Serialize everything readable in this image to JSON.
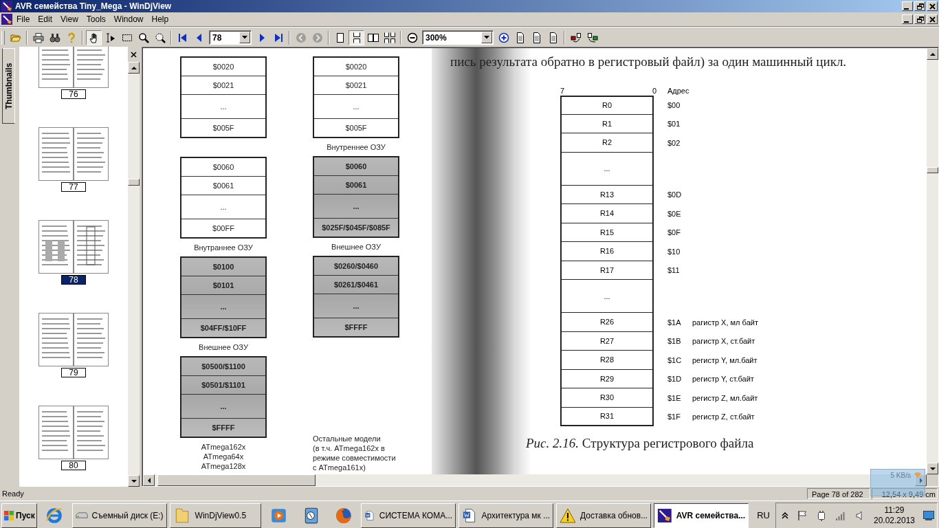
{
  "window": {
    "title": "AVR семейства Tiny_Mega - WinDjView"
  },
  "menu": [
    "File",
    "Edit",
    "View",
    "Tools",
    "Window",
    "Help"
  ],
  "toolbar": [
    [
      {
        "kind": "open",
        "selected": false,
        "disabled": false
      }
    ],
    [
      {
        "kind": "print",
        "selected": false,
        "disabled": false
      },
      {
        "kind": "find",
        "selected": false,
        "disabled": false
      },
      {
        "kind": "help",
        "selected": false,
        "disabled": false
      }
    ],
    [
      {
        "kind": "hand",
        "selected": true,
        "disabled": false
      },
      {
        "kind": "textsel",
        "selected": false,
        "disabled": false
      },
      {
        "kind": "rectsel",
        "selected": false,
        "disabled": false
      },
      {
        "kind": "zoom",
        "selected": false,
        "disabled": false
      },
      {
        "kind": "zoomrect",
        "selected": false,
        "disabled": false
      }
    ],
    [
      {
        "kind": "first",
        "selected": false,
        "disabled": false
      },
      {
        "kind": "prev",
        "selected": false,
        "disabled": false
      },
      {
        "kind": "pagecombo",
        "value": "78"
      },
      {
        "kind": "next",
        "selected": false,
        "disabled": false
      },
      {
        "kind": "last",
        "selected": false,
        "disabled": false
      }
    ],
    [
      {
        "kind": "back",
        "selected": false,
        "disabled": true
      },
      {
        "kind": "forward",
        "selected": false,
        "disabled": true
      }
    ],
    [
      {
        "kind": "single",
        "selected": false,
        "disabled": false
      },
      {
        "kind": "continuous",
        "selected": true,
        "disabled": false
      },
      {
        "kind": "facing",
        "selected": false,
        "disabled": false
      },
      {
        "kind": "facingcont",
        "selected": false,
        "disabled": false
      }
    ],
    [
      {
        "kind": "zoomout",
        "selected": false,
        "disabled": false
      },
      {
        "kind": "zoomcombo",
        "value": "300%"
      },
      {
        "kind": "zoomin",
        "selected": false,
        "disabled": false
      },
      {
        "kind": "page",
        "selected": false,
        "disabled": false
      },
      {
        "kind": "page",
        "selected": false,
        "disabled": false
      },
      {
        "kind": "page",
        "selected": false,
        "disabled": false
      }
    ],
    [
      {
        "kind": "rotl",
        "selected": false,
        "disabled": false
      },
      {
        "kind": "rotr",
        "selected": false,
        "disabled": false
      }
    ]
  ],
  "thumbnails": {
    "tab": "Thumbnails",
    "pages": [
      {
        "label": "76",
        "selected": false
      },
      {
        "label": "77",
        "selected": false
      },
      {
        "label": "78",
        "selected": true
      },
      {
        "label": "79",
        "selected": false
      },
      {
        "label": "80",
        "selected": false
      }
    ]
  },
  "left_page": {
    "columns": [
      [
        {
          "kind": "block",
          "shaded": false,
          "cells": [
            "$0020",
            "$0021",
            "...",
            "$005F"
          ]
        },
        {
          "kind": "block",
          "shaded": false,
          "cells": [
            "$0060",
            "$0061",
            "...",
            "$00FF"
          ]
        },
        {
          "kind": "caption",
          "lines": [
            "Внутраннее ОЗУ"
          ]
        },
        {
          "kind": "block",
          "shaded": true,
          "cells": [
            "$0100",
            "$0101",
            "...",
            "$04FF/$10FF"
          ]
        },
        {
          "kind": "caption",
          "lines": [
            "Внешнее ОЗУ"
          ]
        },
        {
          "kind": "block",
          "shaded": true,
          "cells": [
            "$0500/$1100",
            "$0501/$1101",
            "...",
            "$FFFF"
          ]
        },
        {
          "kind": "caption",
          "lines": [
            "ATmega162x",
            "ATmega64x",
            "ATmega128x"
          ]
        }
      ],
      [
        {
          "kind": "block",
          "shaded": false,
          "cells": [
            "$0020",
            "$0021",
            "...",
            "$005F"
          ]
        },
        {
          "kind": "caption",
          "lines": [
            "Внутреннее ОЗУ"
          ]
        },
        {
          "kind": "block",
          "shaded": true,
          "cells": [
            "$0060",
            "$0061",
            "...",
            "$025F/$045F/$085F"
          ]
        },
        {
          "kind": "caption",
          "lines": [
            "Внешнее ОЗУ"
          ]
        },
        {
          "kind": "block",
          "shaded": true,
          "cells": [
            "$0260/$0460",
            "$0261/$0461",
            "...",
            "$FFFF"
          ]
        },
        {
          "kind": "note",
          "lines": [
            "Остальные модели",
            "(в т.ч. ATmega162x в",
            "режиме совместимости",
            "с ATmega161x)"
          ]
        }
      ]
    ]
  },
  "right_page": {
    "text": "пись результата обратно в регистровый файл) за один машинный цикл.",
    "bits": [
      "7",
      "0"
    ],
    "address_header": "Адрес",
    "registers": [
      {
        "kind": "register",
        "name": "R0",
        "address": "$00"
      },
      {
        "kind": "register",
        "name": "R1",
        "address": "$01"
      },
      {
        "kind": "register",
        "name": "R2",
        "address": "$02"
      },
      {
        "kind": "ellipsis",
        "name": "..."
      },
      {
        "kind": "register",
        "name": "R13",
        "address": "$0D"
      },
      {
        "kind": "register",
        "name": "R14",
        "address": "$0E"
      },
      {
        "kind": "register",
        "name": "R15",
        "address": "$0F"
      },
      {
        "kind": "register",
        "name": "R16",
        "address": "$10"
      },
      {
        "kind": "register",
        "name": "R17",
        "address": "$11"
      },
      {
        "kind": "ellipsis",
        "name": "..."
      },
      {
        "kind": "register",
        "name": "R26",
        "address": "$1A",
        "note": "рагистр X, мл байт"
      },
      {
        "kind": "register",
        "name": "R27",
        "address": "$1B",
        "note": "рагистр X, ст.байт"
      },
      {
        "kind": "register",
        "name": "R28",
        "address": "$1C",
        "note": "регистр Y, мл.байт"
      },
      {
        "kind": "register",
        "name": "R29",
        "address": "$1D",
        "note": "регистр Y, ст.байт"
      },
      {
        "kind": "register",
        "name": "R30",
        "address": "$1E",
        "note": "регистр Z, мл.байт"
      },
      {
        "kind": "register",
        "name": "R31",
        "address": "$1F",
        "note": "регистр Z, ст.байт"
      }
    ],
    "caption": "*Рис. 2.16.* Структура регистрового файла"
  },
  "status_bar": {
    "message": "Ready",
    "page": "Page 78 of 282",
    "size": "12,54 x 9,49 cm"
  },
  "network_meter": {
    "speed": "5 KB/s"
  },
  "taskbar": {
    "start": "Пуск",
    "items": [
      {
        "kind": "ie",
        "selected": false
      },
      {
        "kind": "drive",
        "label": "Съемный диск (E:)",
        "selected": false
      },
      {
        "kind": "folder",
        "label": "WinDjView0.5",
        "selected": false
      },
      {
        "kind": "media",
        "selected": false
      },
      {
        "kind": "player",
        "selected": false
      },
      {
        "kind": "firefox",
        "selected": false
      },
      {
        "kind": "word",
        "label": "СИСТЕМА КОМА...",
        "selected": false
      },
      {
        "kind": "word",
        "label": "Архитектура мк ...",
        "selected": false
      },
      {
        "kind": "warning",
        "label": "Доставка обнов...",
        "selected": false
      },
      {
        "kind": "djview",
        "label": "AVR семейства...",
        "selected": true
      }
    ],
    "language": "RU",
    "time": "11:29",
    "date": "20.02.2013"
  }
}
